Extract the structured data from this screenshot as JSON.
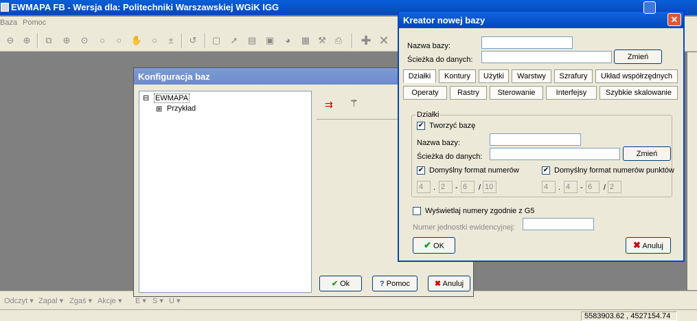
{
  "app": {
    "title": "EWMAPA FB - Wersja dla: Politechniki Warszawskiej WGiK IGG",
    "menu": [
      "Baza",
      "Pomoc"
    ]
  },
  "bottom_toolbar": [
    "Odczyt",
    "Zapal",
    "Zgaś",
    "Akcje",
    "E",
    "S",
    "U"
  ],
  "statusbar": {
    "coords": "5583903.62 , 4527154.74"
  },
  "config_dialog": {
    "title": "Konfiguracja baz",
    "tree": {
      "root": "EWMAPA",
      "child": "Przykład",
      "root_toggle": "⊟",
      "child_toggle": "⊞"
    },
    "buttons": {
      "ok": "Ok",
      "help": "Pomoc",
      "cancel": "Anuluj"
    }
  },
  "wizard": {
    "title": "Kreator nowej bazy",
    "db_name_label": "Nazwa bazy:",
    "db_name_value": "",
    "path_label": "Ścieżka do danych:",
    "path_value": "",
    "change_button": "Zmień",
    "tabs_row1": [
      "Działki",
      "Kontury",
      "Użytki",
      "Warstwy",
      "Szrafury",
      "Układ współrzędnych"
    ],
    "tabs_row2": [
      "Operaty",
      "Rastry",
      "Sterowanie",
      "Interfejsy",
      "Szybkie skalowanie"
    ],
    "selected_tab": "Działki",
    "group": {
      "title": "Działki",
      "create_db_label": "Tworzyć bazę",
      "create_db_checked": true,
      "db_name_label": "Nazwa bazy:",
      "path_label": "Ścieżka do danych:",
      "change_button": "Zmień",
      "default_format_label": "Domyślny format numerów",
      "default_format_checked": true,
      "default_point_format_label": "Domyślny format numerów punktów",
      "default_point_format_checked": true,
      "format_values": [
        "4",
        "2",
        "6",
        "10"
      ],
      "point_format_values": [
        "4",
        "4",
        "6",
        "2"
      ],
      "sep_dot": ".",
      "sep_dash": "-",
      "sep_slash": "/"
    },
    "show_g5_label": "Wyświetlaj numery zgodnie z G5",
    "show_g5_checked": false,
    "unit_number_label": "Numer jednostki ewidencyjnej:",
    "ok_button": "OK",
    "cancel_button": "Anuluj"
  },
  "colors": {
    "title_active": "#0446c0",
    "title_inactive": "#7e9bd6",
    "dialog_bg": "#ece9d8",
    "workspace": "#808080"
  }
}
